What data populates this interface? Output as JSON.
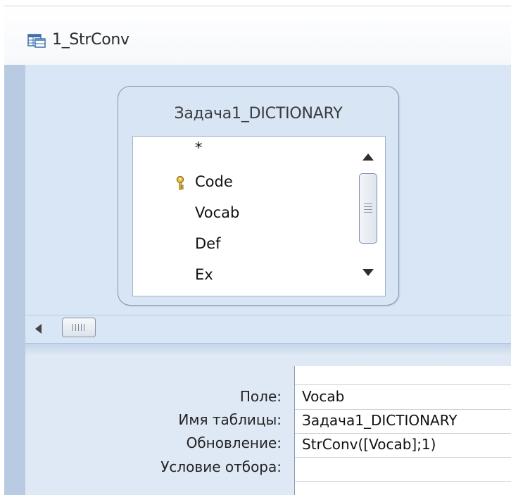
{
  "window": {
    "title": "1_StrConv",
    "icon": "query-icon"
  },
  "field_list": {
    "title": "Задача1_DICTIONARY",
    "items": [
      {
        "label": "*",
        "key": false
      },
      {
        "label": "Code",
        "key": true
      },
      {
        "label": "Vocab",
        "key": false
      },
      {
        "label": "Def",
        "key": false
      },
      {
        "label": "Ex",
        "key": false
      }
    ]
  },
  "grid": {
    "rows": [
      {
        "label": "Поле:",
        "value": "Vocab"
      },
      {
        "label": "Имя таблицы:",
        "value": "Задача1_DICTIONARY"
      },
      {
        "label": "Обновление:",
        "value": "StrConv([Vocab];1)"
      },
      {
        "label": "Условие отбора:",
        "value": ""
      }
    ]
  },
  "colors": {
    "window_bg": "#dbe6f4",
    "accent": "#7d97b9"
  }
}
